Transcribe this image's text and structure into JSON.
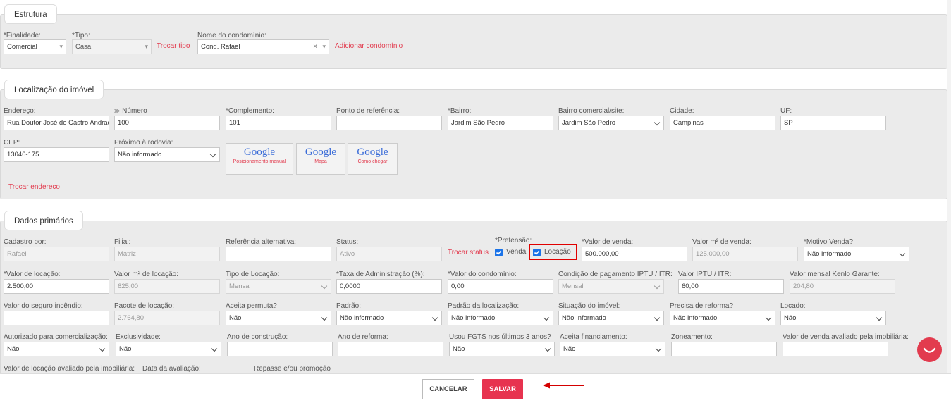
{
  "estrutura": {
    "legend": "Estrutura",
    "finalidade_label": "*Finalidade:",
    "finalidade_value": "Comercial",
    "tipo_label": "*Tipo:",
    "tipo_value": "Casa",
    "trocar_tipo": "Trocar tipo",
    "condominio_label": "Nome do condomínio:",
    "condominio_value": "Cond. Rafael",
    "adicionar_condominio": "Adicionar condomínio"
  },
  "localizacao": {
    "legend": "Localização do imóvel",
    "endereco_label": "Endereço:",
    "endereco_value": "Rua Doutor José de Castro Andrade",
    "numero_label": "Número",
    "numero_value": "100",
    "complemento_label": "*Complemento:",
    "complemento_value": "101",
    "referencia_label": "Ponto de referência:",
    "referencia_value": "",
    "bairro_label": "*Bairro:",
    "bairro_value": "Jardim São Pedro",
    "bairro_comercial_label": "Bairro comercial/site:",
    "bairro_comercial_value": "Jardim São Pedro",
    "cidade_label": "Cidade:",
    "cidade_value": "Campinas",
    "uf_label": "UF:",
    "uf_value": "SP",
    "cep_label": "CEP:",
    "cep_value": "13046-175",
    "rodovia_label": "Próximo à rodovia:",
    "rodovia_value": "Não informado",
    "google_brand": "Google",
    "google1": "Posicionamento manual",
    "google2": "Mapa",
    "google3": "Como chegar",
    "trocar_endereco": "Trocar endereco"
  },
  "dados": {
    "legend": "Dados primários",
    "cadastro_label": "Cadastro por:",
    "cadastro_value": "Rafael",
    "filial_label": "Filial:",
    "filial_value": "Matriz",
    "ref_alt_label": "Referência alternativa:",
    "ref_alt_value": "",
    "status_label": "Status:",
    "status_value": "Ativo",
    "trocar_status": "Trocar status",
    "pretensao_label": "*Pretensão:",
    "venda_label": "Venda",
    "locacao_label": "Locação",
    "valor_venda_label": "*Valor de venda:",
    "valor_venda_value": "500.000,00",
    "valor_m2_venda_label": "Valor m² de venda:",
    "valor_m2_venda_value": "125.000,00",
    "motivo_venda_label": "*Motivo Venda?",
    "motivo_venda_value": "Não informado",
    "valor_locacao_label": "*Valor de locação:",
    "valor_locacao_value": "2.500,00",
    "valor_m2_locacao_label": "Valor m² de locação:",
    "valor_m2_locacao_value": "625,00",
    "tipo_locacao_label": "Tipo de Locação:",
    "tipo_locacao_value": "Mensal",
    "taxa_adm_label": "*Taxa de Administração (%):",
    "taxa_adm_value": "0,0000",
    "valor_condominio_label": "*Valor do condomínio:",
    "valor_condominio_value": "0,00",
    "cond_iptu_label": "Condição de pagamento IPTU / ITR:",
    "cond_iptu_value": "Mensal",
    "valor_iptu_label": "Valor IPTU / ITR:",
    "valor_iptu_value": "60,00",
    "kenlo_label": "Valor mensal Kenlo Garante:",
    "kenlo_value": "204,80",
    "seguro_label": "Valor do seguro incêndio:",
    "seguro_value": "",
    "pacote_label": "Pacote de locação:",
    "pacote_value": "2.764,80",
    "permuta_label": "Aceita permuta?",
    "permuta_value": "Não",
    "padrao_label": "Padrão:",
    "padrao_value": "Não informado",
    "padrao_loc_label": "Padrão da localização:",
    "padrao_loc_value": "Não informado",
    "situacao_label": "Situação do imóvel:",
    "situacao_value": "Não Informado",
    "reforma_label": "Precisa de reforma?",
    "reforma_value": "Não informado",
    "locado_label": "Locado:",
    "locado_value": "Não",
    "autorizado_label": "Autorizado para comercialização:",
    "autorizado_value": "Não",
    "exclusividade_label": "Exclusividade:",
    "exclusividade_value": "Não",
    "ano_construcao_label": "Ano de construção:",
    "ano_construcao_value": "",
    "ano_reforma_label": "Ano de reforma:",
    "ano_reforma_value": "",
    "fgts_label": "Usou FGTS nos últimos 3 anos?",
    "fgts_value": "Não",
    "financiamento_label": "Aceita financiamento:",
    "financiamento_value": "Não",
    "zoneamento_label": "Zoneamento:",
    "zoneamento_value": "",
    "venda_avaliado_label": "Valor de venda avaliado pela imobiliária:",
    "venda_avaliado_value": "",
    "locacao_avaliado_label": "Valor de locação avaliado pela imobiliária:",
    "data_avaliacao_label": "Data da avaliação:",
    "repasse_label": "Repasse e/ou promoção"
  },
  "footer": {
    "cancelar": "CANCELAR",
    "salvar": "SALVAR"
  },
  "colors": {
    "accent": "#e23b4e",
    "highlight": "#e00000",
    "checkbox": "#1a73e8"
  }
}
